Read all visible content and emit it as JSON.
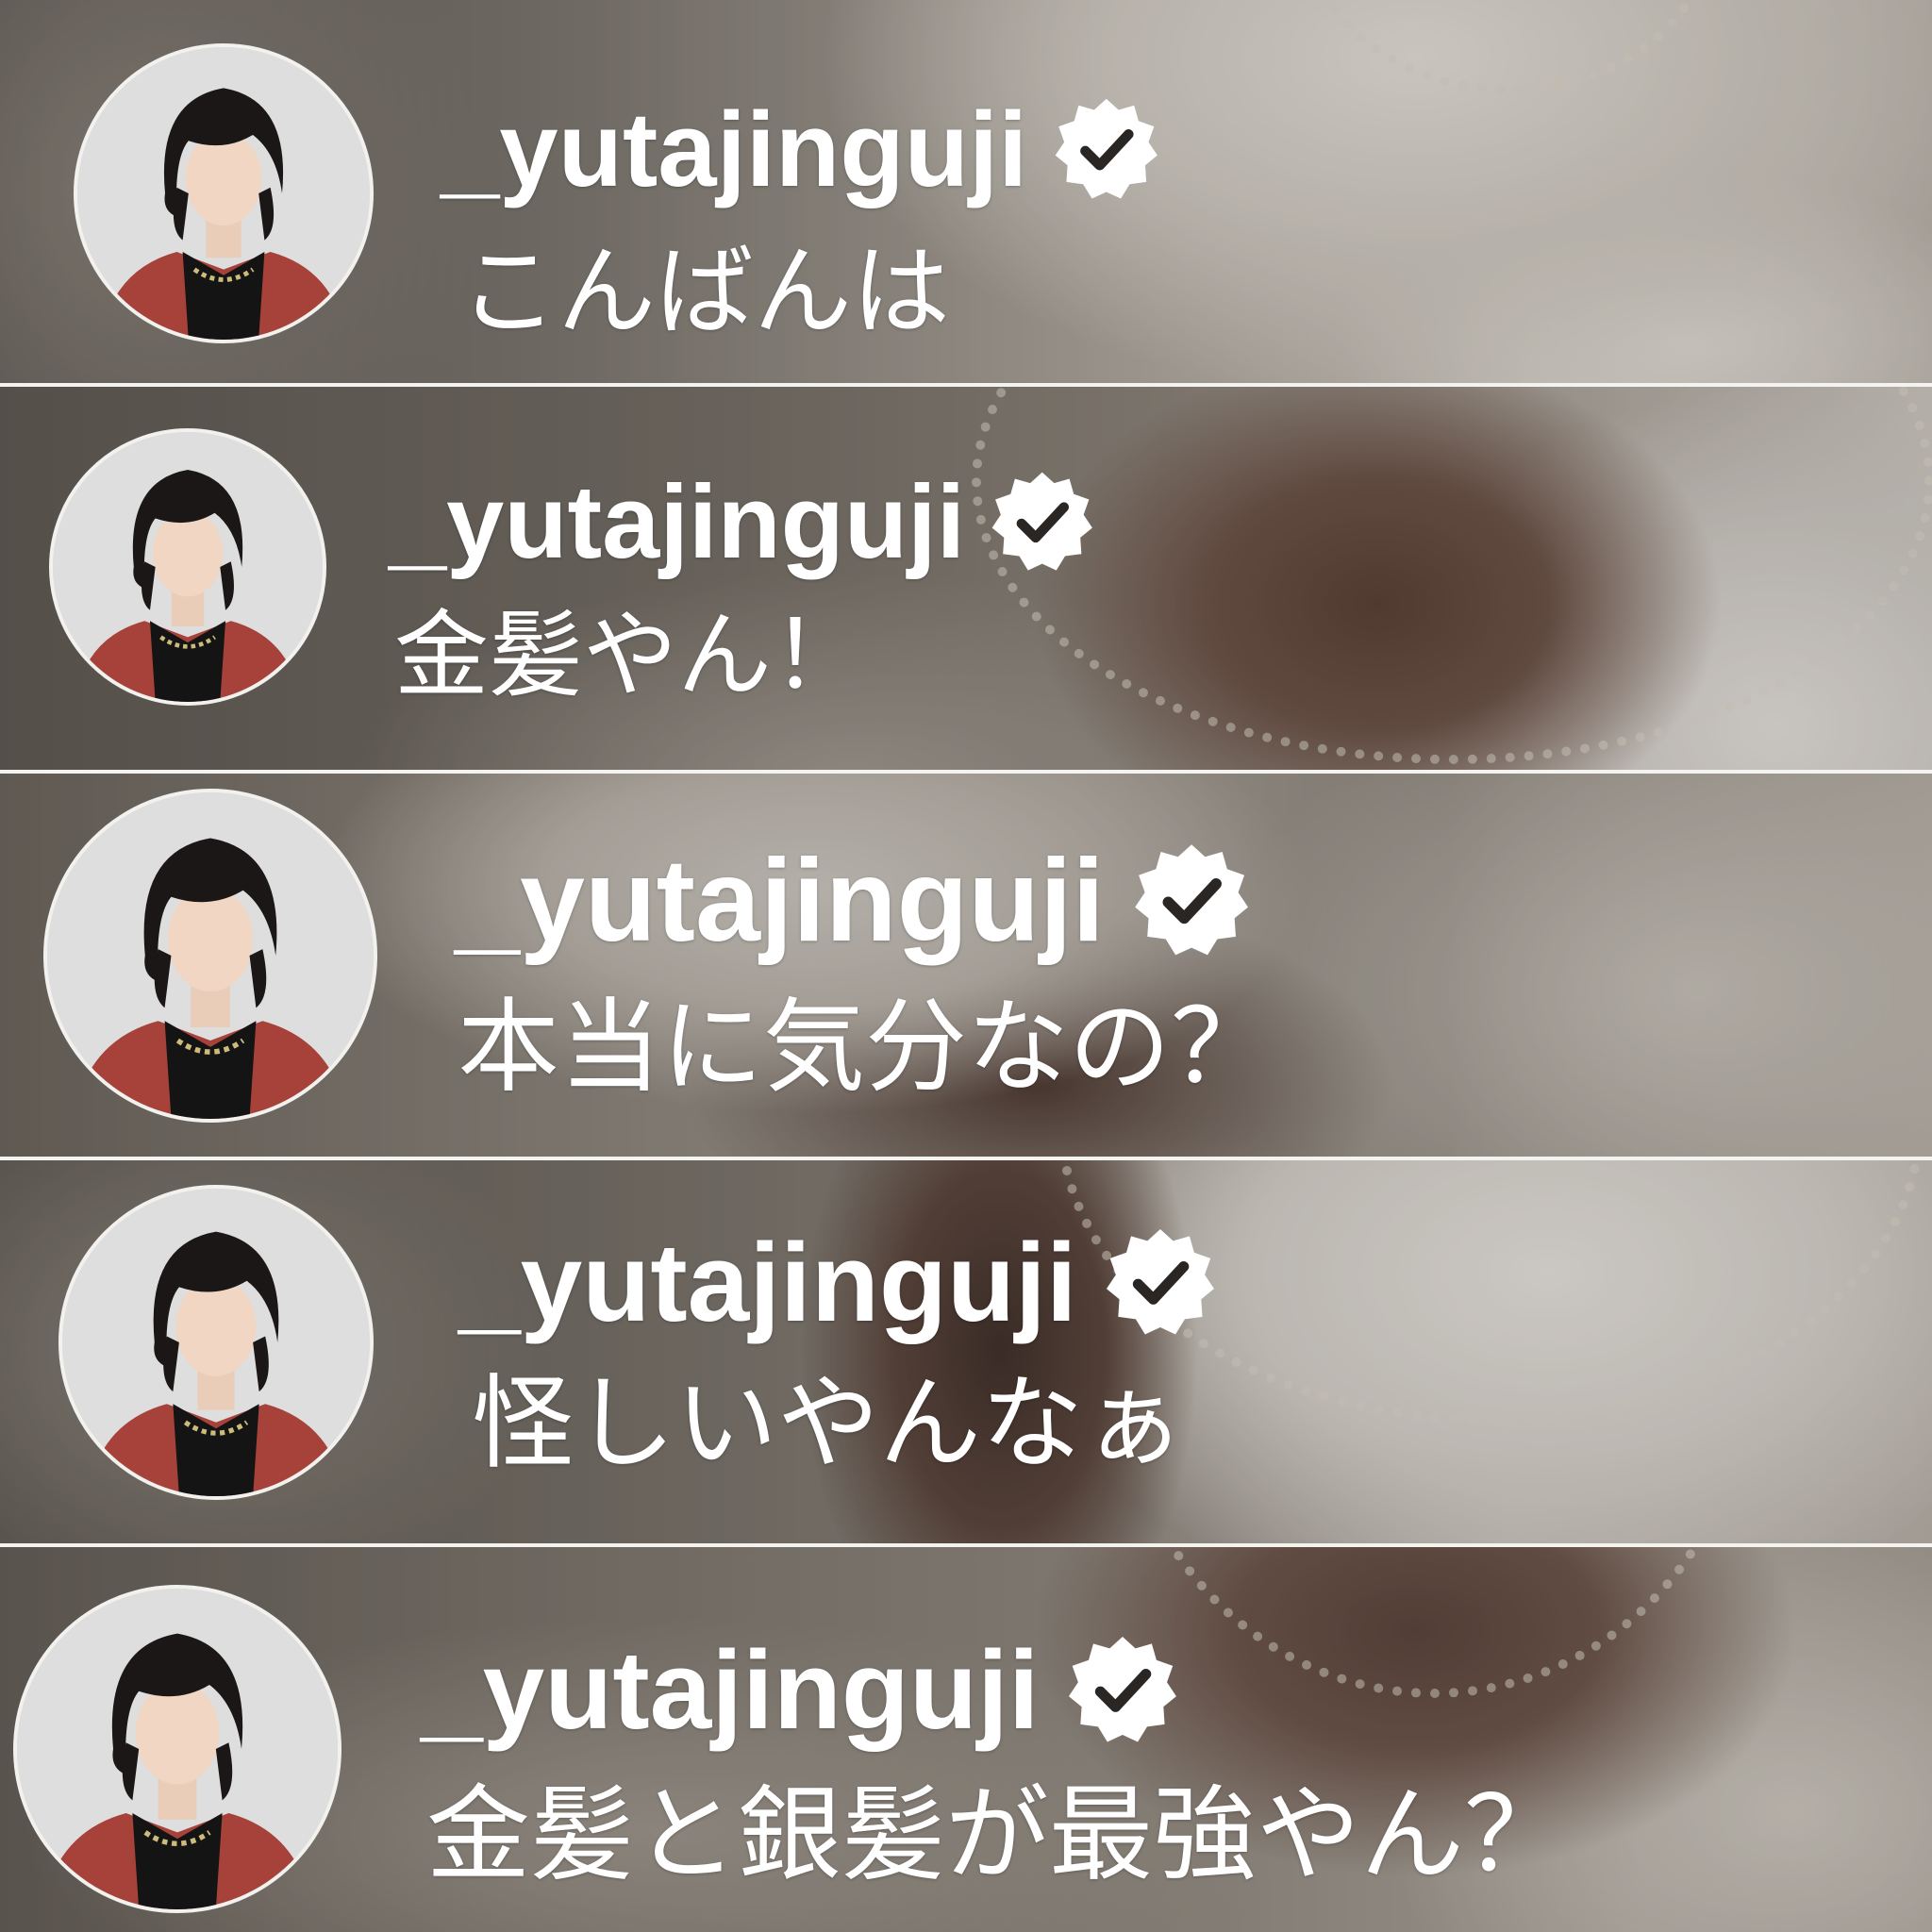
{
  "colors": {
    "text": "#ffffff",
    "avatar_ring": "#f2f1ee",
    "verified_badge": "#ffffff",
    "verified_check": "#2a2623",
    "avatar_jacket": "#a6423a"
  },
  "icons": {
    "verified": "verified-badge-icon",
    "avatar": "profile-avatar"
  },
  "comments": [
    {
      "username": "_yutajinguji",
      "text": "こんばんは"
    },
    {
      "username": "_yutajinguji",
      "text": "金髪やん！"
    },
    {
      "username": "_yutajinguji",
      "text": "本当に気分なの？"
    },
    {
      "username": "_yutajinguji",
      "text": "怪しいやんなぁ"
    },
    {
      "username": "_yutajinguji",
      "text": "金髪と銀髪が最強やん？"
    }
  ]
}
